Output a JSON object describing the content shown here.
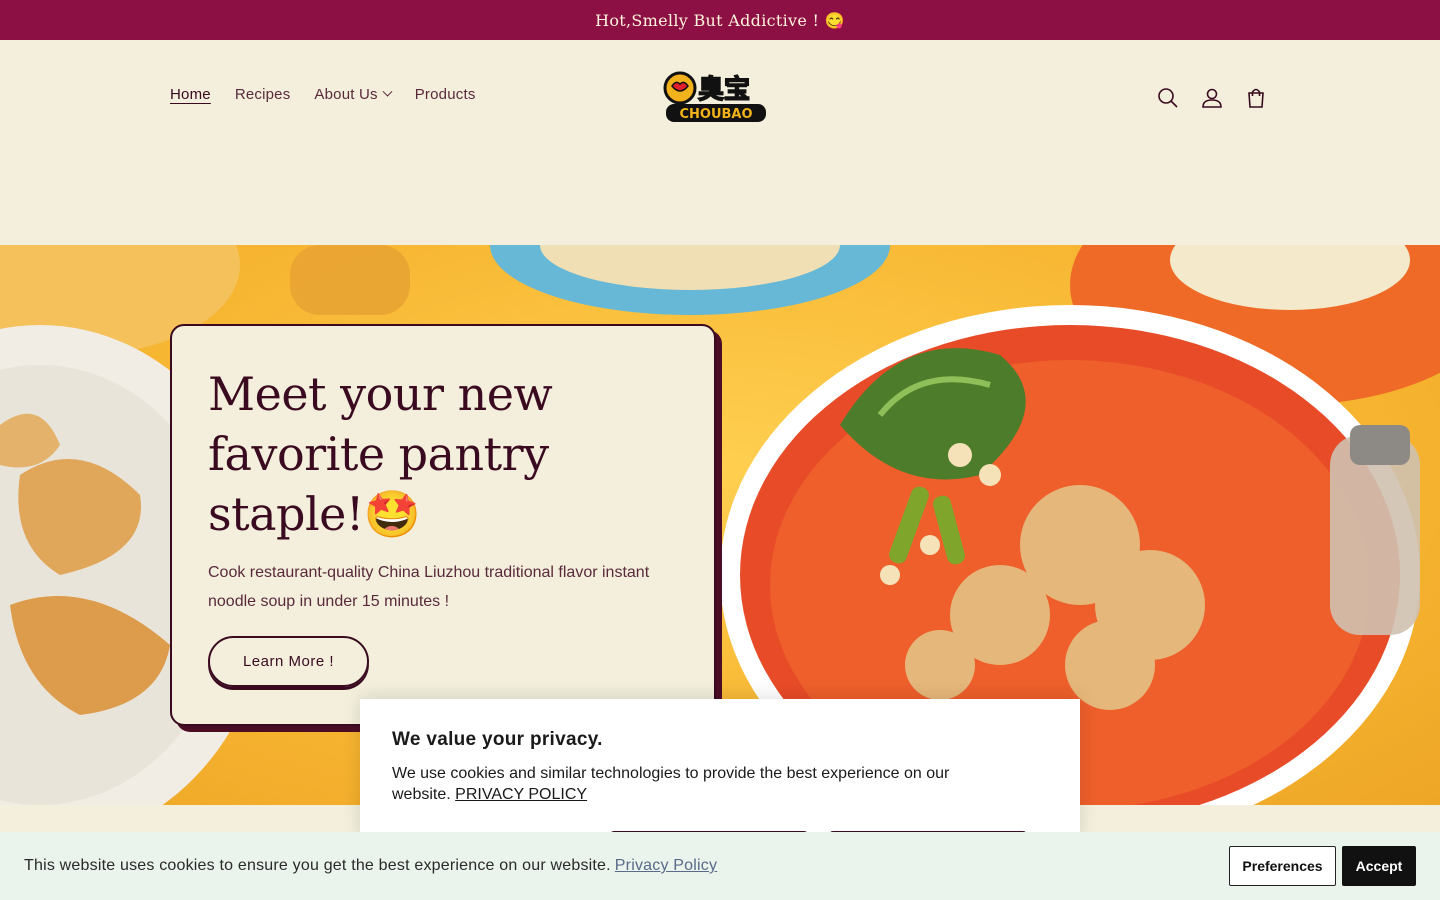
{
  "announcement": {
    "text": "Hot,Smelly But Addictive ! 😋"
  },
  "nav": {
    "items": [
      {
        "label": "Home"
      },
      {
        "label": "Recipes"
      },
      {
        "label": "About Us"
      },
      {
        "label": "Products"
      }
    ]
  },
  "logo": {
    "cn": "臭宝",
    "en": "CHOUBAO"
  },
  "header_icons": [
    "search-icon",
    "account-icon",
    "cart-icon"
  ],
  "hero": {
    "title": "Meet your new favorite pantry staple!🤩",
    "subtitle": "Cook restaurant-quality China Liuzhou traditional flavor instant noodle soup in under 15 minutes !",
    "button_label": "Learn More !"
  },
  "privacy_modal": {
    "title": "We value your privacy.",
    "text": "We use cookies and similar technologies to provide the best experience on our website.",
    "link_label": "PRIVACY POLICY"
  },
  "cookie_bar": {
    "text": "This website uses cookies to ensure you get the best experience on our website.",
    "link_label": "Privacy Policy",
    "preferences_label": "Preferences",
    "accept_label": "Accept"
  },
  "colors": {
    "brand": "#8c1043",
    "cream": "#f3efdc",
    "ink": "#3a0a20",
    "hero_bg": "#f7b632"
  }
}
